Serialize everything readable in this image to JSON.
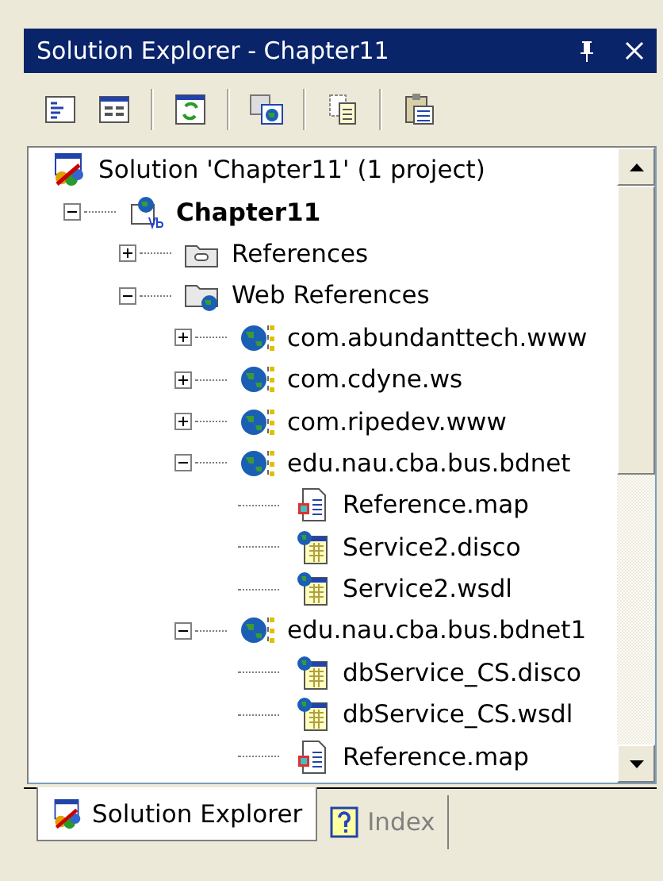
{
  "window": {
    "title": "Solution Explorer - Chapter11"
  },
  "toolbar_groups": [
    [
      {
        "kind": "properties"
      },
      {
        "kind": "show-all"
      }
    ],
    [
      {
        "kind": "refresh"
      }
    ],
    [
      {
        "kind": "view-browser"
      }
    ],
    [
      {
        "kind": "copy"
      }
    ],
    [
      {
        "kind": "clipboard"
      }
    ]
  ],
  "tree": [
    {
      "label": "Solution 'Chapter11' (1 project)",
      "kind": "solution",
      "bold": false,
      "children": [
        {
          "label": "Chapter11",
          "kind": "project",
          "bold": true,
          "expanded": true,
          "children": [
            {
              "label": "References",
              "kind": "folder",
              "bold": false,
              "expanded": false
            },
            {
              "label": "Web References",
              "kind": "web-folder",
              "bold": false,
              "expanded": true,
              "children": [
                {
                  "label": "com.abundanttech.www",
                  "kind": "web-service",
                  "bold": false,
                  "expanded": false
                },
                {
                  "label": "com.cdyne.ws",
                  "kind": "web-service",
                  "bold": false,
                  "expanded": false
                },
                {
                  "label": "com.ripedev.www",
                  "kind": "web-service",
                  "bold": false,
                  "expanded": false
                },
                {
                  "label": "edu.nau.cba.bus.bdnet",
                  "kind": "web-service",
                  "bold": false,
                  "expanded": true,
                  "children": [
                    {
                      "label": "Reference.map",
                      "kind": "map-file",
                      "bold": false
                    },
                    {
                      "label": "Service2.disco",
                      "kind": "service-file",
                      "bold": false
                    },
                    {
                      "label": "Service2.wsdl",
                      "kind": "service-file",
                      "bold": false
                    }
                  ]
                },
                {
                  "label": "edu.nau.cba.bus.bdnet1",
                  "kind": "web-service",
                  "bold": false,
                  "expanded": true,
                  "children": [
                    {
                      "label": "dbService_CS.disco",
                      "kind": "service-file",
                      "bold": false
                    },
                    {
                      "label": "dbService_CS.wsdl",
                      "kind": "service-file",
                      "bold": false
                    },
                    {
                      "label": "Reference.map",
                      "kind": "map-file",
                      "bold": false
                    }
                  ]
                }
              ]
            }
          ]
        }
      ]
    }
  ],
  "tabs": [
    {
      "label": "Solution Explorer",
      "kind": "solution",
      "selected": true
    },
    {
      "label": "Index",
      "kind": "help",
      "selected": false
    }
  ]
}
